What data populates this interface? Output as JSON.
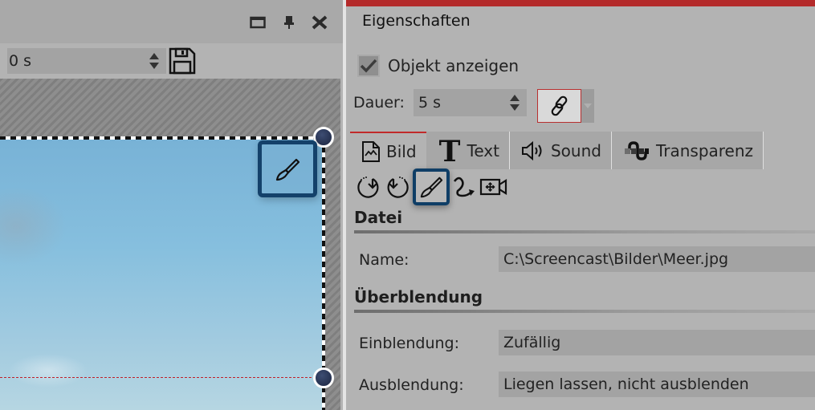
{
  "left_pane": {
    "window_buttons": [
      {
        "name": "maximize",
        "icon": "maximize-icon"
      },
      {
        "name": "pin",
        "icon": "pin-icon"
      },
      {
        "name": "close",
        "icon": "close-icon"
      }
    ],
    "time_input": {
      "value": "0 s"
    },
    "save_icon": "save-icon",
    "canvas": {
      "image_description": "sky with clouds",
      "edit_button_icon": "brush-icon"
    }
  },
  "properties": {
    "title": "Eigenschaften",
    "show_object": {
      "label": "Objekt anzeigen",
      "checked": true
    },
    "duration": {
      "label": "Dauer:",
      "value": "5 s"
    },
    "link_icon": "link-icon",
    "tabs": [
      {
        "label": "Bild",
        "icon": "image-file-icon",
        "active": true
      },
      {
        "label": "Text",
        "icon": "text-icon",
        "active": false
      },
      {
        "label": "Sound",
        "icon": "speaker-icon",
        "active": false
      },
      {
        "label": "Transparenz",
        "icon": "transparency-icon",
        "active": false
      }
    ],
    "tools": [
      {
        "name": "rotate-left",
        "icon": "rotate-left-icon"
      },
      {
        "name": "rotate-right",
        "icon": "rotate-right-icon"
      },
      {
        "name": "image-editor",
        "icon": "brush-icon",
        "selected": true
      },
      {
        "name": "motion-path",
        "icon": "curve-arrow-icon"
      },
      {
        "name": "camera-pan",
        "icon": "camera-move-icon"
      }
    ],
    "sections": {
      "file": {
        "title": "Datei",
        "name_label": "Name:",
        "name_value": "C:\\Screencast\\Bilder\\Meer.jpg"
      },
      "transition": {
        "title": "Überblendung",
        "fade_in_label": "Einblendung:",
        "fade_in_value": "Zufällig",
        "fade_out_label": "Ausblendung:",
        "fade_out_value": "Liegen lassen, nicht ausblenden"
      }
    }
  },
  "colors": {
    "accent_red": "#b42a2a",
    "selection_blue": "#14416a",
    "panel_gray": "#b3b3b3",
    "field_gray": "#a3a3a3"
  }
}
